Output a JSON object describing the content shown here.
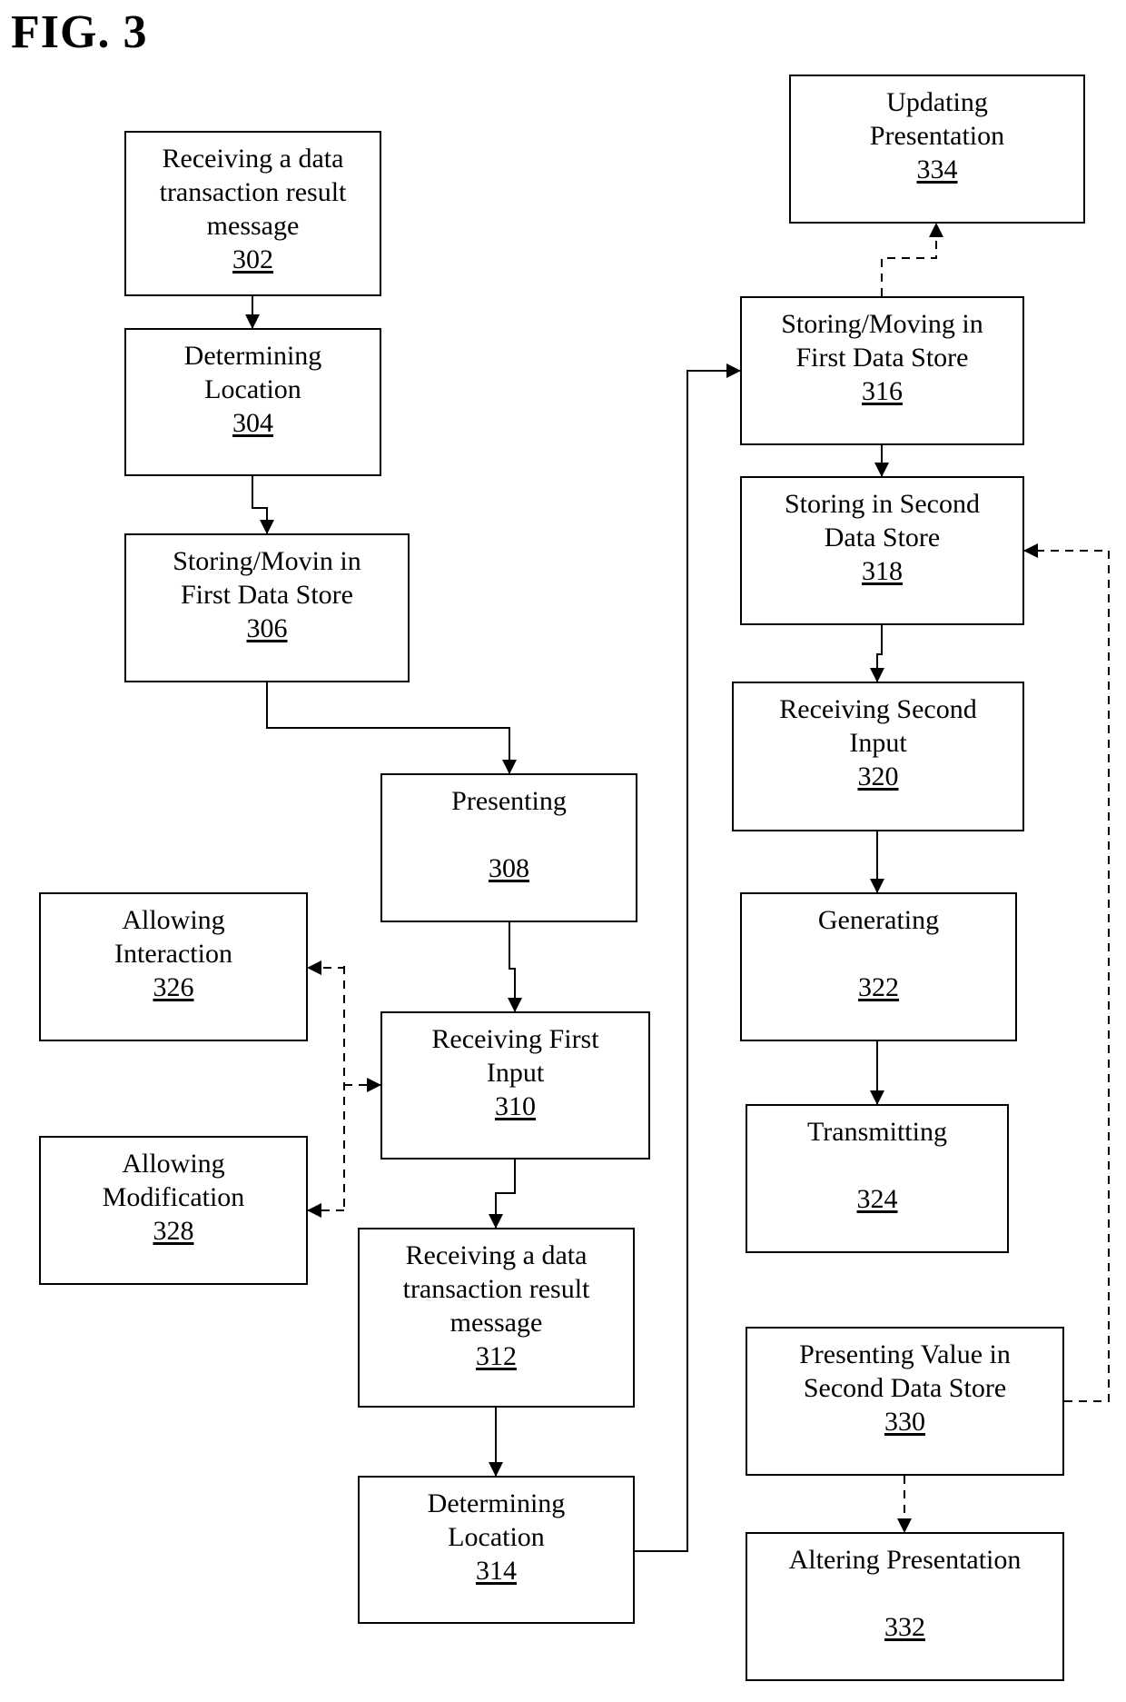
{
  "figure": {
    "title": "FIG. 3"
  },
  "boxes": {
    "b302": {
      "label": "Receiving a data\ntransaction result\nmessage",
      "number": "302"
    },
    "b304": {
      "label": "Determining\nLocation",
      "number": "304"
    },
    "b306": {
      "label": "Storing/Movin in\nFirst Data Store",
      "number": "306"
    },
    "b308": {
      "label": "Presenting",
      "number": "308"
    },
    "b310": {
      "label": "Receiving First\nInput",
      "number": "310"
    },
    "b312": {
      "label": "Receiving a data\ntransaction result\nmessage",
      "number": "312"
    },
    "b314": {
      "label": "Determining\nLocation",
      "number": "314"
    },
    "b316": {
      "label": "Storing/Moving in\nFirst Data Store",
      "number": "316"
    },
    "b318": {
      "label": "Storing in Second\nData Store",
      "number": "318"
    },
    "b320": {
      "label": "Receiving Second\nInput",
      "number": "320"
    },
    "b322": {
      "label": "Generating",
      "number": "322"
    },
    "b324": {
      "label": "Transmitting",
      "number": "324"
    },
    "b326": {
      "label": "Allowing\nInteraction",
      "number": "326"
    },
    "b328": {
      "label": "Allowing\nModification",
      "number": "328"
    },
    "b330": {
      "label": "Presenting Value in\nSecond Data Store",
      "number": "330"
    },
    "b332": {
      "label": "Altering Presentation",
      "number": "332"
    },
    "b334": {
      "label": "Updating\nPresentation",
      "number": "334"
    }
  },
  "edges": [
    {
      "from": "302",
      "to": "304",
      "style": "solid"
    },
    {
      "from": "304",
      "to": "306",
      "style": "solid"
    },
    {
      "from": "306",
      "to": "308",
      "style": "solid"
    },
    {
      "from": "308",
      "to": "310",
      "style": "solid"
    },
    {
      "from": "310",
      "to": "312",
      "style": "solid"
    },
    {
      "from": "312",
      "to": "314",
      "style": "solid"
    },
    {
      "from": "314",
      "to": "316",
      "style": "solid"
    },
    {
      "from": "316",
      "to": "318",
      "style": "solid"
    },
    {
      "from": "318",
      "to": "320",
      "style": "solid"
    },
    {
      "from": "320",
      "to": "322",
      "style": "solid"
    },
    {
      "from": "322",
      "to": "324",
      "style": "solid"
    },
    {
      "from": "316",
      "to": "334",
      "style": "dashed"
    },
    {
      "from": "310",
      "to": "326",
      "style": "dashed"
    },
    {
      "from": "310",
      "to": "328",
      "style": "dashed"
    },
    {
      "from": "330",
      "to": "318",
      "style": "dashed"
    },
    {
      "from": "330",
      "to": "332",
      "style": "dashed"
    }
  ]
}
